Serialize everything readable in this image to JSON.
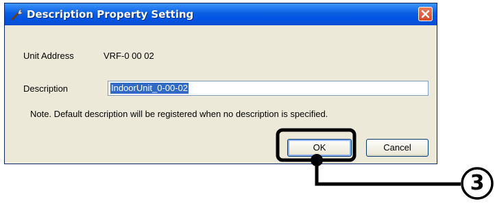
{
  "dialog": {
    "title": "Description Property Setting",
    "unit_address_label": "Unit Address",
    "unit_address_value": "VRF-0 00 02",
    "description_label": "Description",
    "description_value": "IndoorUnit_0-00-02",
    "note": "Note. Default description will be registered when no description is specified.",
    "ok_label": "OK",
    "cancel_label": "Cancel"
  },
  "callout": {
    "step": "3"
  }
}
